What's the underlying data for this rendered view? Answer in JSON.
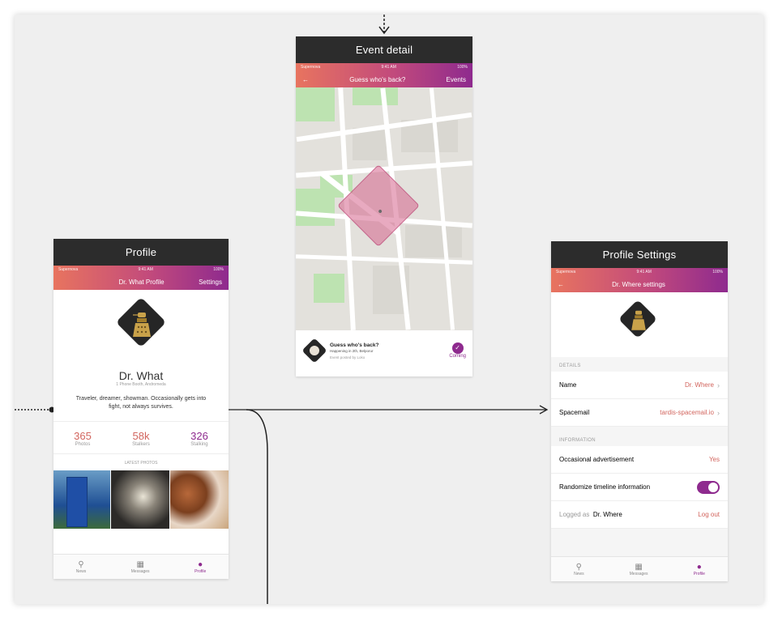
{
  "colors": {
    "accent": "#d2655e",
    "brand_purple": "#8e2a8e",
    "header_dark": "#2c2c2c",
    "gradient_start": "#e8745f",
    "gradient_end": "#8e2a8e"
  },
  "profile": {
    "frame_title": "Profile",
    "status": {
      "carrier": "Supernova",
      "time": "9:41 AM",
      "battery": "100%"
    },
    "nav": {
      "title": "Dr. What Profile",
      "right": "Settings"
    },
    "name": "Dr. What",
    "location": "1 Phone Booth, Andromeda",
    "bio": "Traveler, dreamer, showman. Occasionally gets into fight, not always survives.",
    "stats": [
      {
        "value": "365",
        "label": "Photos"
      },
      {
        "value": "58k",
        "label": "Stalkers"
      },
      {
        "value": "326",
        "label": "Stalking"
      }
    ],
    "latest_photos": "LATEST PHOTOS",
    "tabs": [
      {
        "label": "News",
        "icon": "rocket-icon"
      },
      {
        "label": "Messages",
        "icon": "messages-icon"
      },
      {
        "label": "Profile",
        "icon": "profile-icon"
      }
    ]
  },
  "event": {
    "frame_title": "Event detail",
    "status": {
      "carrier": "Supernova",
      "time": "9:41 AM",
      "battery": "100%"
    },
    "nav": {
      "back": "←",
      "title": "Guess who's back?",
      "right": "Events"
    },
    "card": {
      "title": "Guess who's back?",
      "subtitle": "Happening in 2th, Belporur",
      "posted": "Event posted by Loko",
      "action": "Coming"
    }
  },
  "settings": {
    "frame_title": "Profile Settings",
    "status": {
      "carrier": "Supernova",
      "time": "9:41 AM",
      "battery": "100%"
    },
    "nav": {
      "back": "←",
      "title": "Dr. Where settings"
    },
    "section_details": "DETAILS",
    "name_label": "Name",
    "name_value": "Dr. Where",
    "spacemail_label": "Spacemail",
    "spacemail_value": "tardis-spacemail.io",
    "section_info": "INFORMATION",
    "ads_label": "Occasional advertisement",
    "ads_value": "Yes",
    "random_label": "Randomize timeline information",
    "random_on": true,
    "logged_label": "Logged as",
    "logged_user": "Dr. Where",
    "logout": "Log out",
    "tabs": [
      {
        "label": "News",
        "icon": "rocket-icon"
      },
      {
        "label": "Messages",
        "icon": "messages-icon"
      },
      {
        "label": "Profile",
        "icon": "profile-icon"
      }
    ]
  }
}
